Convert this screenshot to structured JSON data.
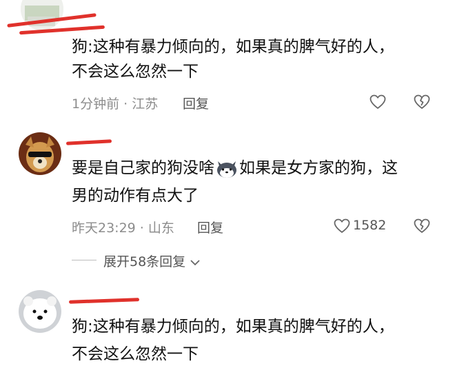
{
  "comments": [
    {
      "username": "",
      "text_lines": [
        "狗:这种有暴力倾向的，如果真的脾气好的人，",
        "不会这么忽然一下"
      ],
      "meta": "1分钟前 · 江苏",
      "reply_label": "回复",
      "likes": ""
    },
    {
      "username": "",
      "text_before_emoji": "要是自己家的狗没啥",
      "emoji": "husky-emoji",
      "text_after_emoji": "如果是女方家的狗，这",
      "text_line2": "男的动作有点大了",
      "meta": "昨天23:29 · 山东",
      "reply_label": "回复",
      "likes": "1582"
    },
    {
      "username": "",
      "text_lines": [
        "狗:这种有暴力倾向的，如果真的脾气好的人，",
        "不会这么忽然一下"
      ],
      "meta": "",
      "reply_label": "",
      "likes": ""
    }
  ],
  "expand_replies_label": "展开58条回复",
  "colors": {
    "redaction": "#e0312b",
    "meta_text": "#8c8c8c",
    "body_text": "#111111"
  },
  "icons": [
    "heart-icon",
    "broken-heart-icon",
    "chevron-down-icon"
  ]
}
